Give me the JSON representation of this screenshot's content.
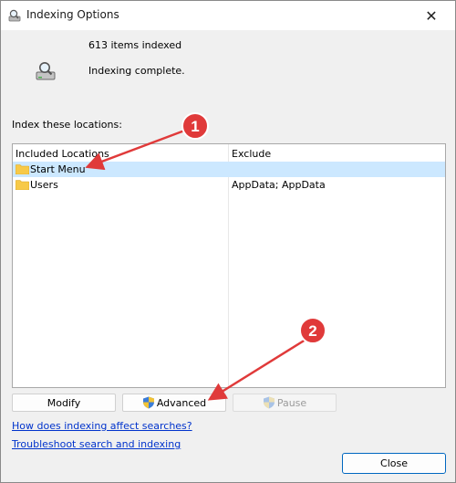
{
  "window": {
    "title": "Indexing Options",
    "close_glyph": "✕"
  },
  "status": {
    "count_text": "613 items indexed",
    "state_text": "Indexing complete."
  },
  "locations": {
    "label": "Index these locations:",
    "columns": [
      "Included Locations",
      "Exclude"
    ],
    "rows": [
      {
        "name": "Start Menu",
        "exclude": "",
        "selected": true
      },
      {
        "name": "Users",
        "exclude": "AppData; AppData",
        "selected": false
      }
    ]
  },
  "buttons": {
    "modify": "Modify",
    "advanced": "Advanced",
    "pause": "Pause",
    "close": "Close"
  },
  "links": {
    "how_indexing": "How does indexing affect searches?",
    "troubleshoot": "Troubleshoot search and indexing"
  },
  "annotations": {
    "marker_1": "1",
    "marker_2": "2",
    "color": "#e03a3a"
  },
  "colors": {
    "selection": "#cce8ff",
    "link": "#0033cc",
    "accent_border": "#0067c0"
  }
}
